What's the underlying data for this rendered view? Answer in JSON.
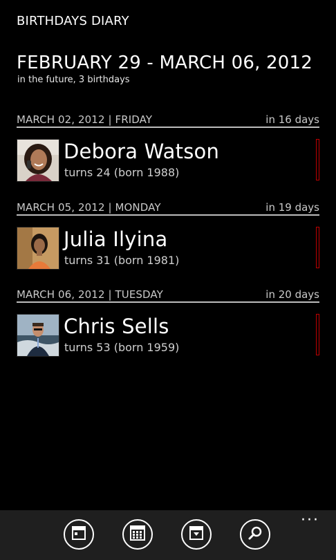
{
  "app": {
    "title": "BIRTHDAYS DIARY"
  },
  "range": {
    "title": "FEBRUARY 29 - MARCH 06, 2012",
    "subtitle": "in the future, 3 birthdays"
  },
  "sections": [
    {
      "date": "MARCH 02, 2012 | FRIDAY",
      "relative": "in 16 days",
      "person": {
        "name": "Debora Watson",
        "turns": "turns 24 (born 1988)"
      }
    },
    {
      "date": "MARCH 05, 2012 | MONDAY",
      "relative": "in 19 days",
      "person": {
        "name": "Julia Ilyina",
        "turns": "turns 31 (born 1981)"
      }
    },
    {
      "date": "MARCH 06, 2012 | TUESDAY",
      "relative": "in 20 days",
      "person": {
        "name": "Chris Sells",
        "turns": "turns 53 (born 1959)"
      }
    }
  ],
  "appbar": {
    "buttons": [
      "today-icon",
      "calendar-icon",
      "archive-icon",
      "search-icon"
    ],
    "more": "···"
  },
  "colors": {
    "background": "#000000",
    "accent": "#c00000",
    "appbar": "#1f1f1f"
  }
}
